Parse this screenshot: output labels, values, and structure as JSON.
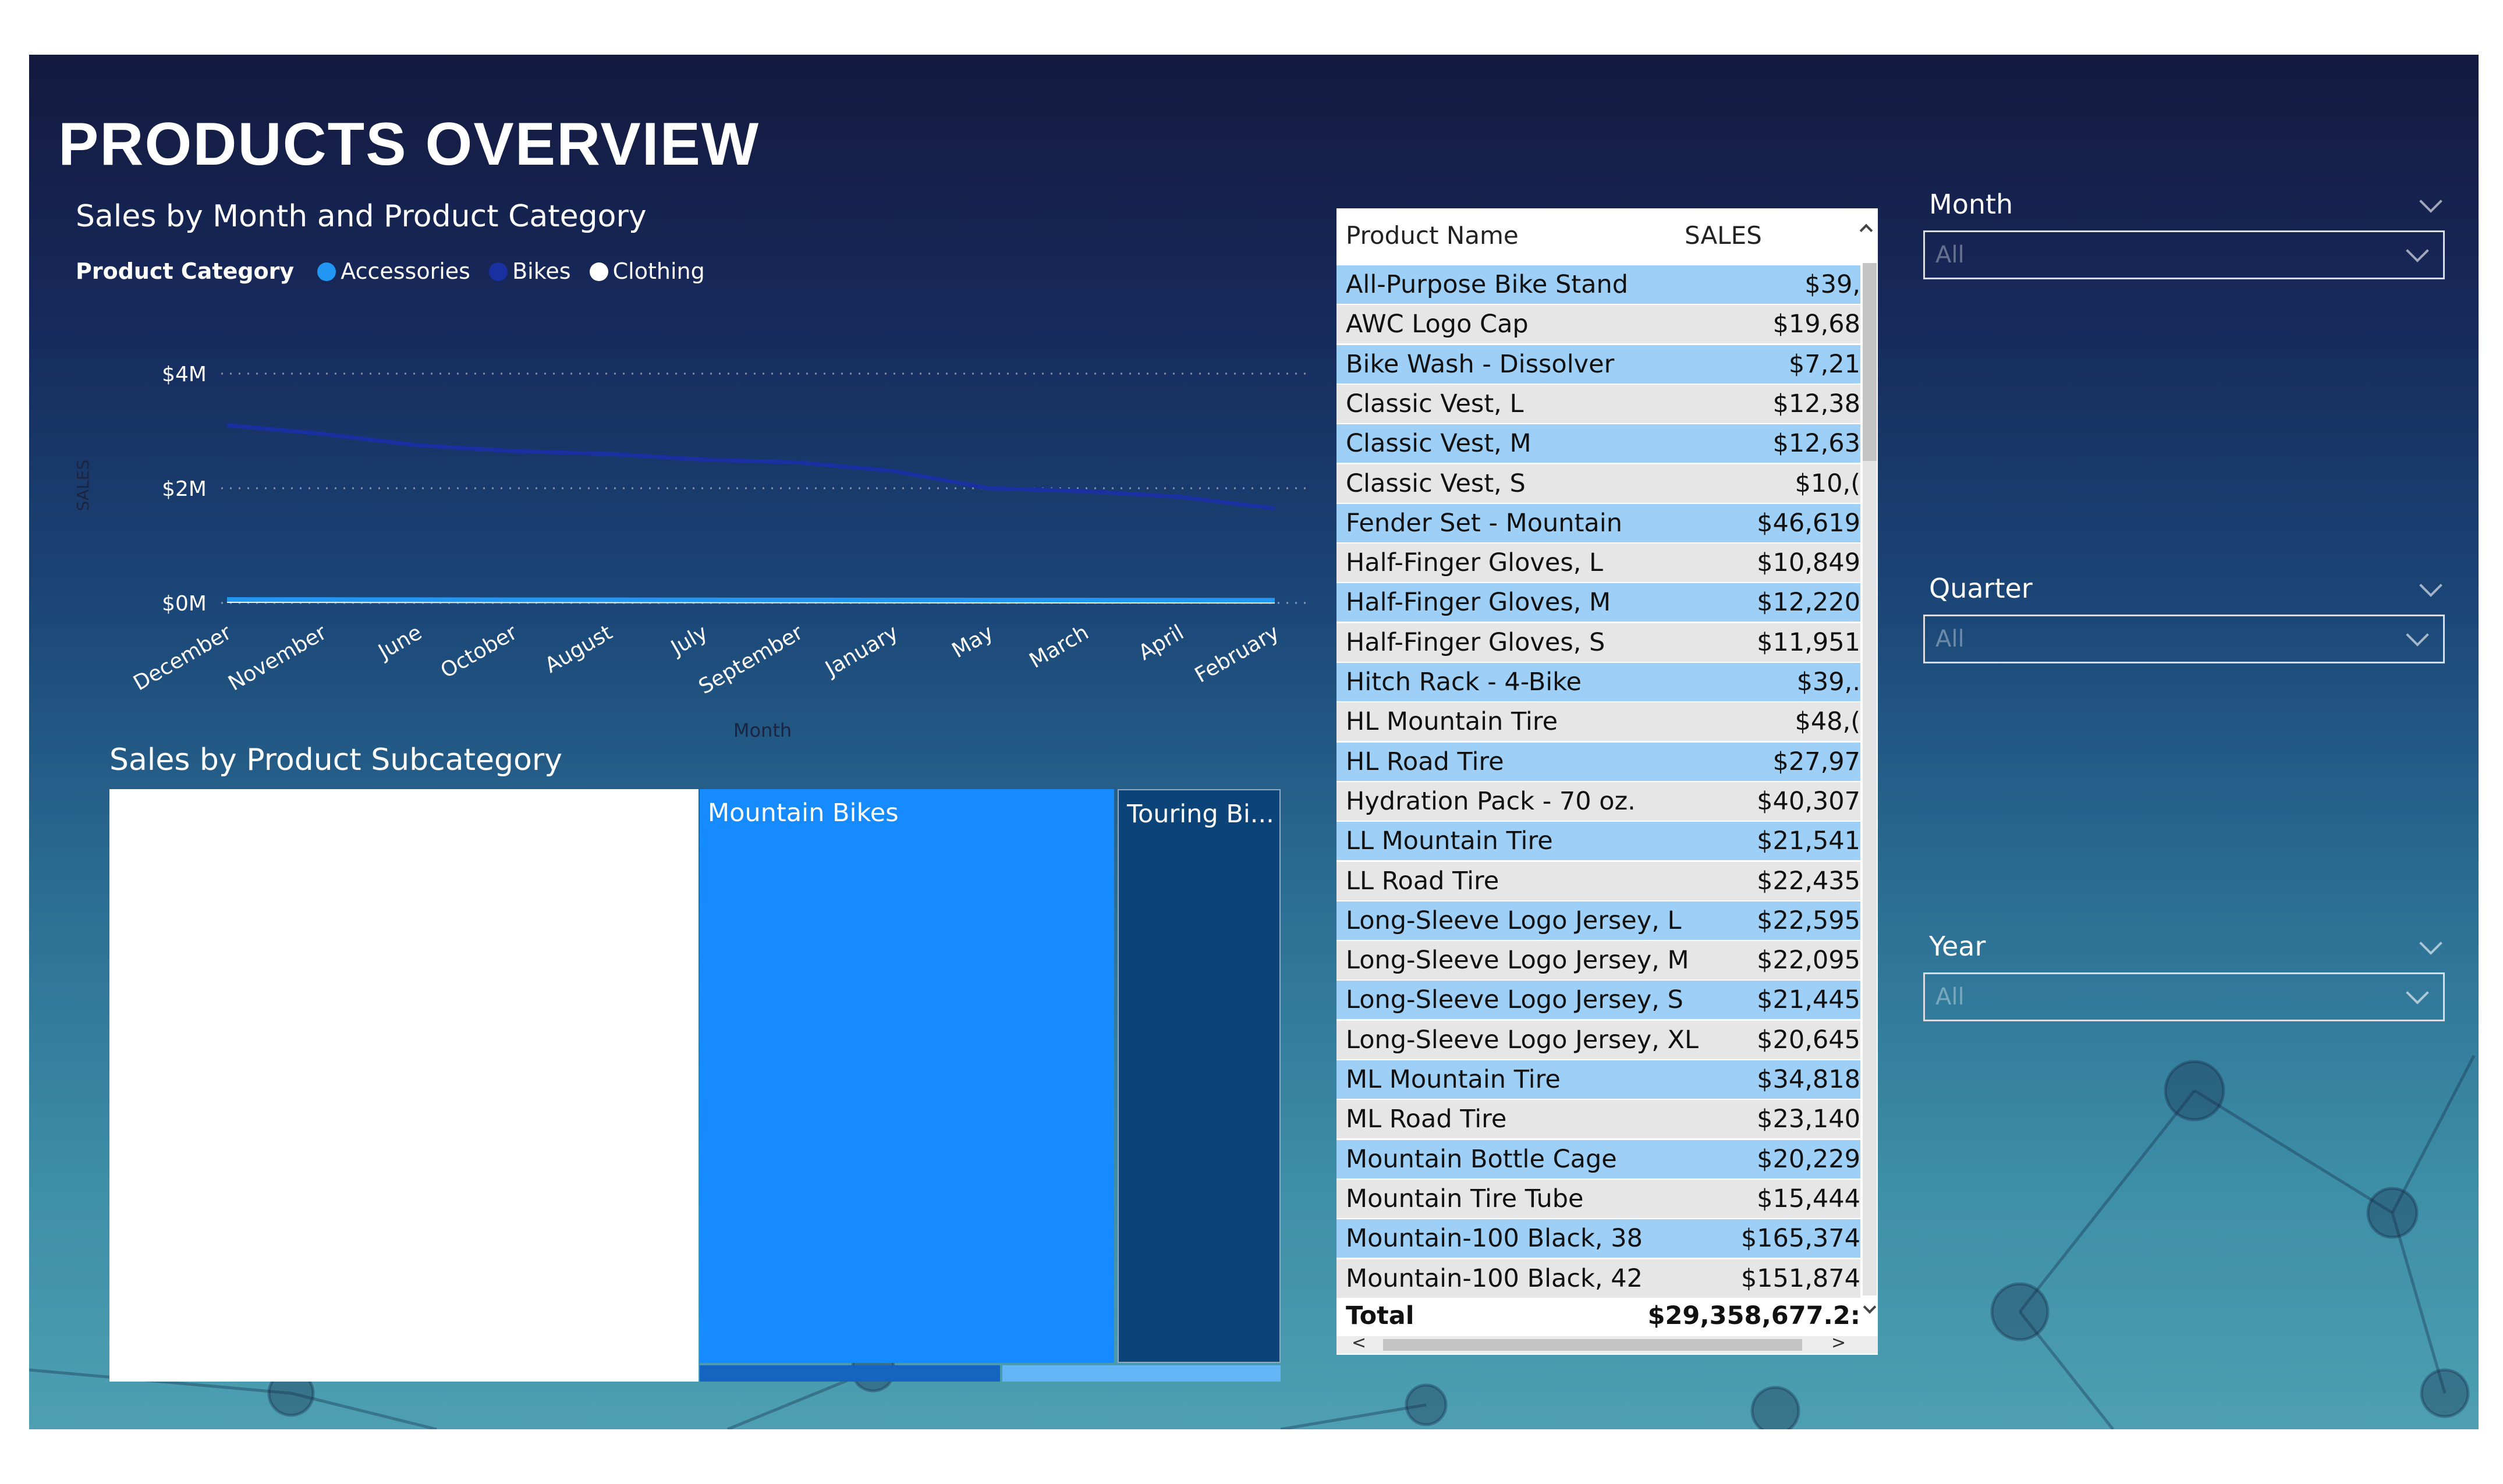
{
  "page_title": "PRODUCTS OVERVIEW",
  "line_chart": {
    "title": "Sales by Month and Product Category",
    "legend_title": "Product Category",
    "legend": [
      {
        "label": "Accessories",
        "color": "#2196f3"
      },
      {
        "label": "Bikes",
        "color": "#1a2fa0"
      },
      {
        "label": "Clothing",
        "color": "#ffffff"
      }
    ],
    "y_ticks": [
      "$4M",
      "$2M",
      "$0M"
    ],
    "y_axis_label": "SALES",
    "x_axis_label": "Month"
  },
  "chart_data": {
    "type": "line",
    "title": "Sales by Month and Product Category",
    "xlabel": "Month",
    "ylabel": "SALES",
    "ylim": [
      0,
      4000000
    ],
    "grid": true,
    "legend_placement": "top-left",
    "categories": [
      "December",
      "November",
      "June",
      "October",
      "August",
      "July",
      "September",
      "January",
      "May",
      "March",
      "April",
      "February"
    ],
    "series": [
      {
        "name": "Accessories",
        "color": "#2196f3",
        "values": [
          60000,
          58000,
          57000,
          55000,
          54000,
          53000,
          52000,
          51000,
          50000,
          49000,
          48000,
          47000
        ]
      },
      {
        "name": "Bikes",
        "color": "#1a2fa0",
        "values": [
          3100000,
          2950000,
          2750000,
          2650000,
          2600000,
          2500000,
          2450000,
          2300000,
          2000000,
          1950000,
          1850000,
          1650000
        ]
      },
      {
        "name": "Clothing",
        "color": "#ffffff",
        "values": [
          40000,
          39000,
          38000,
          37000,
          36000,
          35000,
          34000,
          33000,
          32000,
          31000,
          30000,
          29000
        ]
      }
    ]
  },
  "treemap": {
    "title": "Sales by Product Subcategory",
    "tiles": [
      "Mountain Bikes",
      "Touring Bi..."
    ]
  },
  "table": {
    "headers": [
      "Product Name",
      "SALES"
    ],
    "rows": [
      [
        "All-Purpose Bike Stand",
        "$39,"
      ],
      [
        "AWC Logo Cap",
        "$19,68"
      ],
      [
        "Bike Wash - Dissolver",
        "$7,21"
      ],
      [
        "Classic Vest, L",
        "$12,38"
      ],
      [
        "Classic Vest, M",
        "$12,63"
      ],
      [
        "Classic Vest, S",
        "$10,("
      ],
      [
        "Fender Set - Mountain",
        "$46,619"
      ],
      [
        "Half-Finger Gloves, L",
        "$10,849"
      ],
      [
        "Half-Finger Gloves, M",
        "$12,220"
      ],
      [
        "Half-Finger Gloves, S",
        "$11,951"
      ],
      [
        "Hitch Rack - 4-Bike",
        "$39,."
      ],
      [
        "HL Mountain Tire",
        "$48,("
      ],
      [
        "HL Road Tire",
        "$27,97"
      ],
      [
        "Hydration Pack - 70 oz.",
        "$40,307"
      ],
      [
        "LL Mountain Tire",
        "$21,541"
      ],
      [
        "LL Road Tire",
        "$22,435"
      ],
      [
        "Long-Sleeve Logo Jersey, L",
        "$22,595"
      ],
      [
        "Long-Sleeve Logo Jersey, M",
        "$22,095"
      ],
      [
        "Long-Sleeve Logo Jersey, S",
        "$21,445"
      ],
      [
        "Long-Sleeve Logo Jersey, XL",
        "$20,645"
      ],
      [
        "ML Mountain Tire",
        "$34,818"
      ],
      [
        "ML Road Tire",
        "$23,140"
      ],
      [
        "Mountain Bottle Cage",
        "$20,229"
      ],
      [
        "Mountain Tire Tube",
        "$15,444"
      ],
      [
        "Mountain-100 Black, 38",
        "$165,374"
      ],
      [
        "Mountain-100 Black, 42",
        "$151,874"
      ]
    ],
    "total_label": "Total",
    "total_value": "$29,358,677.2:",
    "row_colors": {
      "odd": "#9ecff7",
      "even": "#e6e6e6"
    }
  },
  "slicers": [
    {
      "label": "Month",
      "value": "All"
    },
    {
      "label": "Quarter",
      "value": "All"
    },
    {
      "label": "Year",
      "value": "All"
    }
  ]
}
